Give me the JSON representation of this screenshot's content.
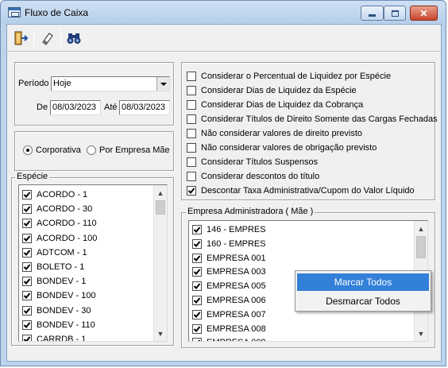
{
  "window": {
    "title": "Fluxo de Caixa",
    "close_glyph": "✕"
  },
  "toolbar": {
    "buttons": [
      {
        "icon": "exit-door-icon"
      },
      {
        "icon": "eraser-icon"
      },
      {
        "icon": "binoculars-icon"
      }
    ]
  },
  "period": {
    "label": "Período",
    "selected": "Hoje",
    "from_label": "De",
    "from_value": "08/03/2023",
    "to_label": "Até",
    "to_value": "08/03/2023"
  },
  "mode": {
    "options": [
      "Corporativa",
      "Por Empresa Mãe"
    ],
    "selected_index": 0
  },
  "especie": {
    "title": "Espécie",
    "items": [
      "ACORDO - 1",
      "ACORDO - 30",
      "ACORDO - 110",
      "ACORDO - 100",
      "ADTCOM - 1",
      "BOLETO - 1",
      "BONDEV - 1",
      "BONDEV - 100",
      "BONDEV - 30",
      "BONDEV - 110",
      "CARRDB - 1"
    ]
  },
  "options": {
    "items": [
      {
        "label": "Considerar o Percentual de Liquidez por Espécie",
        "checked": false
      },
      {
        "label": "Considerar Dias de Liquidez da Espécie",
        "checked": false
      },
      {
        "label": "Considerar Dias de Liquidez da Cobrança",
        "checked": false
      },
      {
        "label": "Considerar Títulos de Direito Somente das Cargas Fechadas",
        "checked": false
      },
      {
        "label": "Não considerar valores de direito previsto",
        "checked": false
      },
      {
        "label": "Não considerar valores de obrigação previsto",
        "checked": false
      },
      {
        "label": "Considerar Títulos Suspensos",
        "checked": false
      },
      {
        "label": "Considerar descontos do título",
        "checked": false
      },
      {
        "label": "Descontar Taxa Administrativa/Cupom do Valor Líquido",
        "checked": true
      }
    ]
  },
  "empresa": {
    "title": "Empresa Administradora ( Mãe )",
    "items": [
      "146 - EMPRES",
      "160 - EMPRES",
      "EMPRESA 001",
      "EMPRESA 003",
      "EMPRESA 005",
      "EMPRESA 006",
      "EMPRESA 007",
      "EMPRESA 008",
      "EMPRESA 009"
    ]
  },
  "context_menu": {
    "items": [
      "Marcar Todos",
      "Desmarcar Todos"
    ],
    "highlighted_index": 0
  },
  "colors": {
    "highlight": "#3380d8",
    "title_bar": "#bcd3ec",
    "close_button": "#c6452c"
  }
}
